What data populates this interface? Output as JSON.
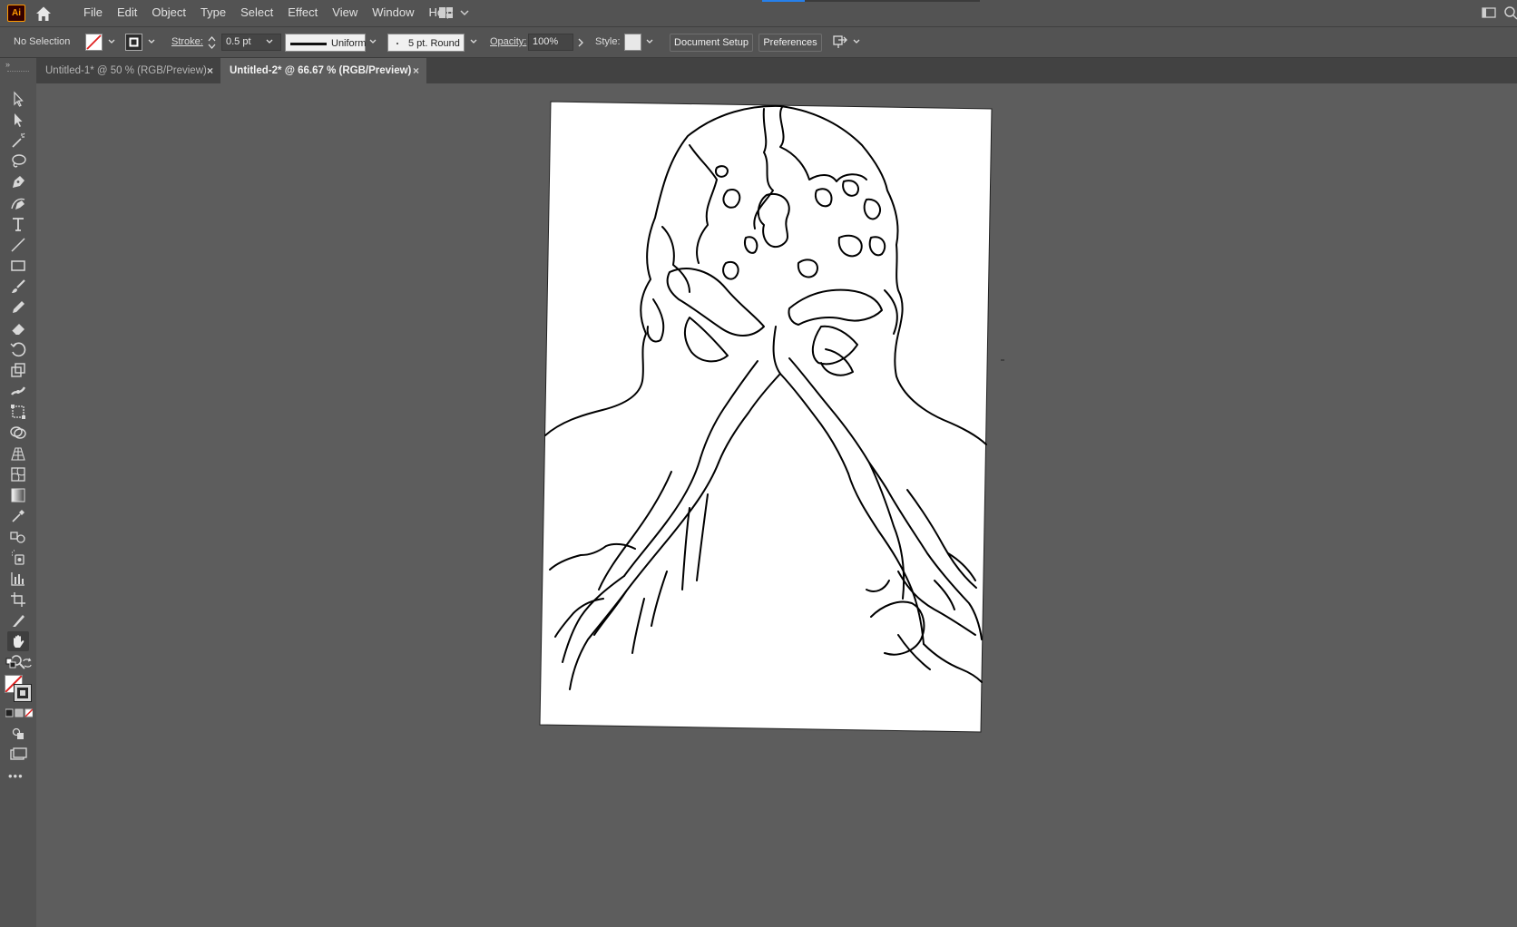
{
  "app": {
    "logo": "Ai"
  },
  "menus": [
    "File",
    "Edit",
    "Object",
    "Type",
    "Select",
    "Effect",
    "View",
    "Window",
    "Help"
  ],
  "control_bar": {
    "selection_status": "No Selection",
    "stroke_label": "Stroke:",
    "stroke_weight": "0.5 pt",
    "stroke_profile": "Uniform",
    "brush": "5 pt. Round",
    "opacity_label": "Opacity:",
    "opacity_value": "100%",
    "style_label": "Style:",
    "document_setup": "Document Setup",
    "preferences": "Preferences"
  },
  "tabs": [
    {
      "label": "Untitled-1* @ 50 % (RGB/Preview)",
      "active": false,
      "close": "×"
    },
    {
      "label": "Untitled-2* @ 66.67 % (RGB/Preview)",
      "active": true,
      "close": "×"
    }
  ],
  "tools": [
    "selection-tool",
    "direct-selection-tool",
    "magic-wand-tool",
    "lasso-tool",
    "pen-tool",
    "curvature-tool",
    "type-tool",
    "line-segment-tool",
    "rectangle-tool",
    "paintbrush-tool",
    "pencil-tool",
    "eraser-tool",
    "rotate-tool",
    "scale-tool",
    "width-tool",
    "free-transform-tool",
    "shape-builder-tool",
    "perspective-grid-tool",
    "mesh-tool",
    "gradient-tool",
    "eyedropper-tool",
    "blend-tool",
    "symbol-sprayer-tool",
    "column-graph-tool",
    "artboard-tool",
    "slice-tool",
    "hand-tool",
    "zoom-tool"
  ],
  "active_tool": "hand-tool",
  "more_tools": "•••",
  "colors": {
    "ui_dark": "#535353",
    "canvas": "#5d5d5d",
    "accent_blue": "#2680eb",
    "logo_orange": "#ff9a00",
    "none_red": "#e02020"
  }
}
